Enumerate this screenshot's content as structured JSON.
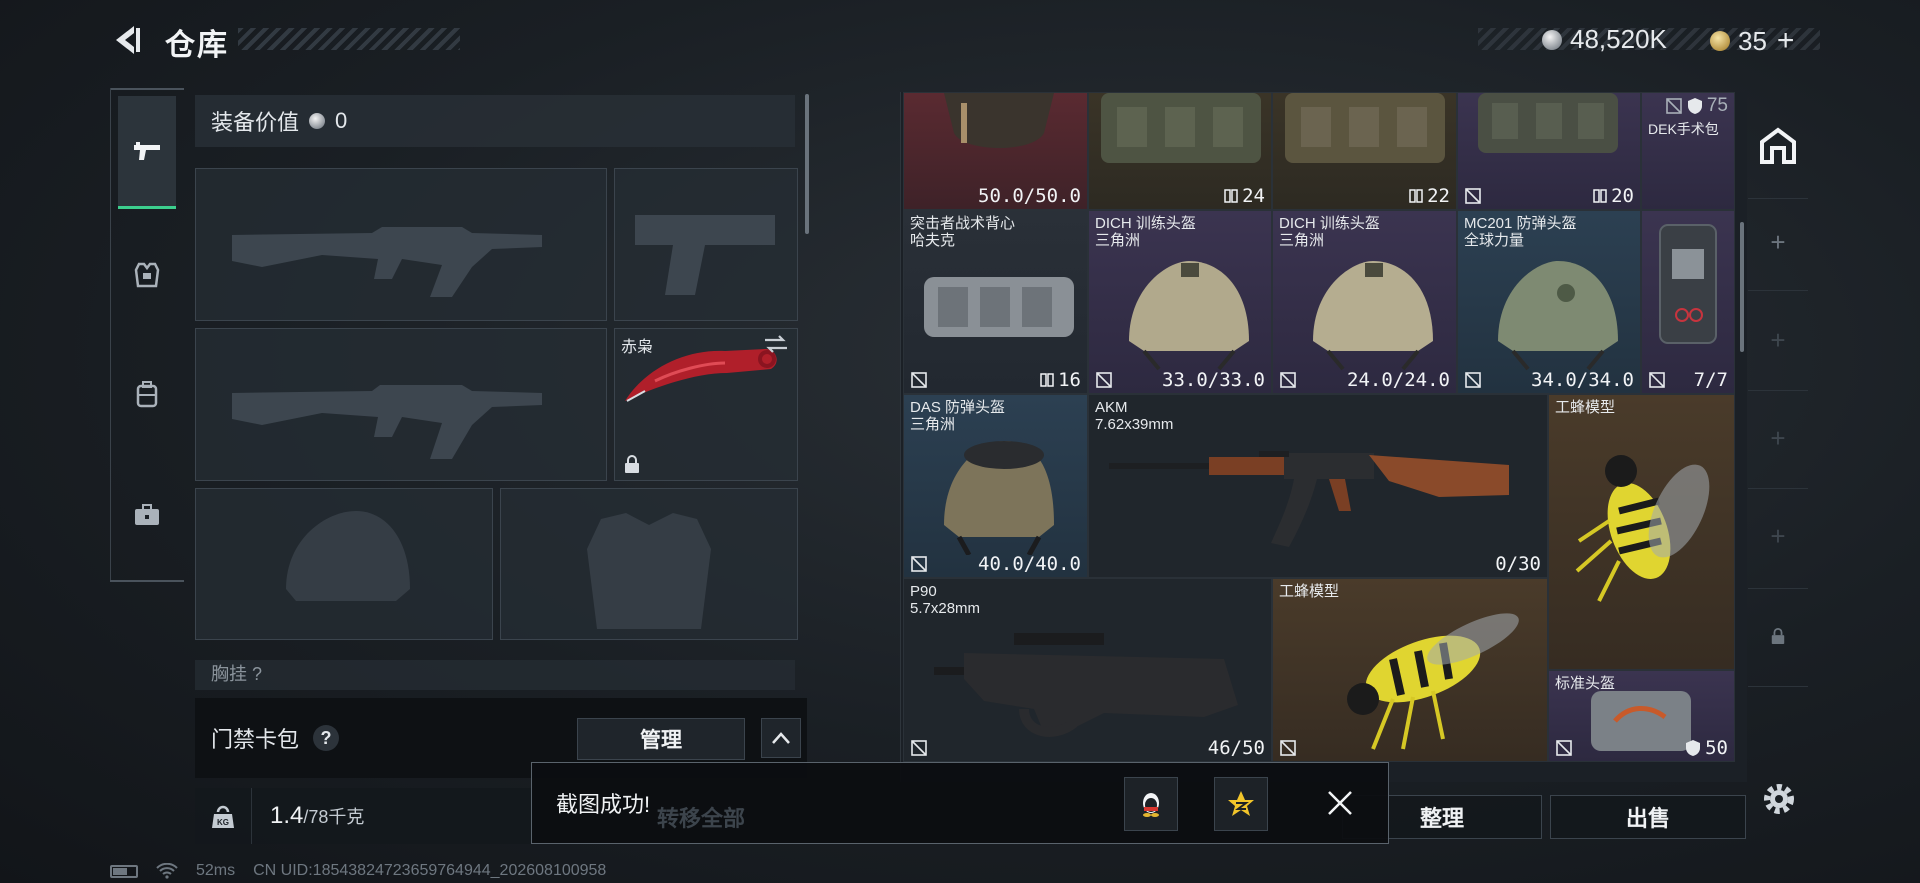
{
  "header": {
    "title": "仓库",
    "silver": "48,520K",
    "gold": "35",
    "gold_plus": "+"
  },
  "equipment": {
    "value_label": "装备价值",
    "value": "0",
    "knife_name": "赤枭",
    "chest_partial": "胸挂 ?"
  },
  "keycard": {
    "label": "门禁卡包",
    "help": "?",
    "manage": "管理"
  },
  "weight": {
    "current": "1.4",
    "max": "/78千克"
  },
  "status": {
    "latency": "52ms",
    "uid": "CN UID:18543824723659764944_202608100958"
  },
  "inventory": {
    "row0": {
      "c0_value": "50.0/50.0",
      "c1_value": "24",
      "c2_value": "22",
      "c3_value": "20",
      "c4_value": "75",
      "c4_name": "DEK手术包"
    },
    "row1": {
      "c0_name": "突击者战术背心\n哈夫克",
      "c0_value": "16",
      "c1_name": "DICH 训练头盔\n三角洲",
      "c1_value": "33.0/33.0",
      "c2_name": "DICH 训练头盔\n三角洲",
      "c2_value": "24.0/24.0",
      "c3_name": "MC201 防弹头盔\n全球力量",
      "c3_value": "34.0/34.0",
      "c4_value": "7/7"
    },
    "row2": {
      "c0_name": "DAS 防弹头盔\n三角洲",
      "c0_value": "40.0/40.0",
      "c1_name": "AKM\n7.62x39mm",
      "c1_value": "0/30",
      "c2_name": "工蜂模型"
    },
    "row3": {
      "c0_name": "P90\n5.7x28mm",
      "c0_value": "46/50",
      "c1_name": "工蜂模型",
      "c2_name": "标准头盔",
      "c2_value": "50"
    }
  },
  "actions": {
    "sort": "整理",
    "sell": "出售",
    "transfer_all": "转移全部"
  },
  "toast": {
    "message": "截图成功!"
  },
  "colors": {
    "accent_green": "#3ccf8e",
    "red_bg": "#5a2a31",
    "purple_bg": "#3b3450",
    "blue_bg": "#2c4052",
    "gold_bg": "#4a3b2a"
  }
}
